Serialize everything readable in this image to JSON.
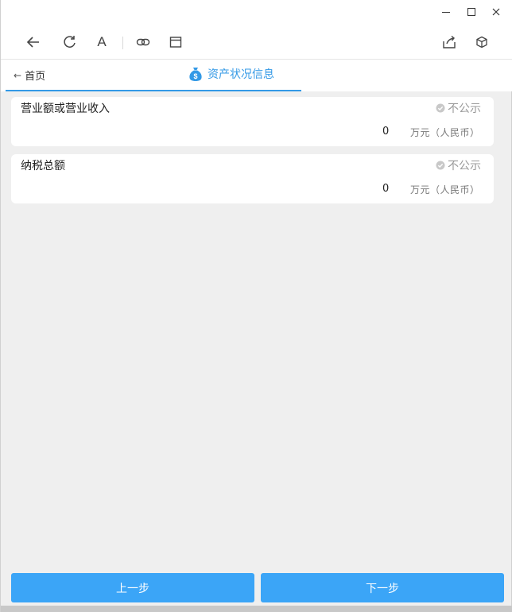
{
  "window": {
    "controls": [
      "minimize",
      "maximize",
      "close"
    ]
  },
  "toolbar": {
    "icons": [
      "back-arrow-icon",
      "refresh-icon",
      "font-icon",
      "link-icon",
      "window-icon",
      "share-icon",
      "cube-icon"
    ],
    "font_glyph": "A"
  },
  "nav": {
    "back_label": "首页",
    "tab_title": "资产状况信息"
  },
  "cards": [
    {
      "label": "营业额或营业收入",
      "public_status": "不公示",
      "value": "0",
      "unit": "万元（人民币）"
    },
    {
      "label": "纳税总额",
      "public_status": "不公示",
      "value": "0",
      "unit": "万元（人民币）"
    }
  ],
  "buttons": {
    "prev": "上一步",
    "next": "下一步"
  },
  "colors": {
    "accent": "#3399e6",
    "button": "#3ba5f7",
    "muted": "#999999"
  }
}
